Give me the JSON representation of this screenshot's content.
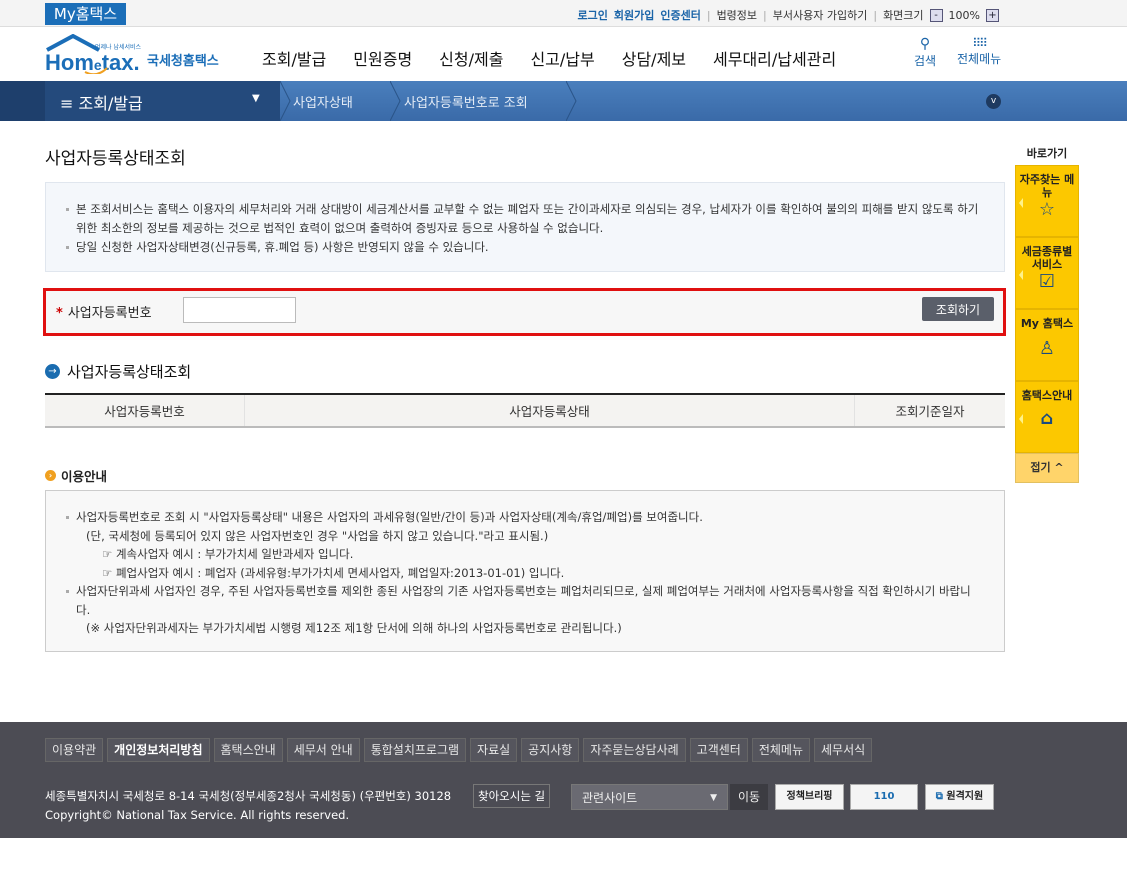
{
  "topbar": {
    "my_hometax": "My홈택스",
    "links": [
      "로그인",
      "회원가입",
      "인증센터",
      "법령정보",
      "부서사용자 가입하기",
      "화면크기"
    ],
    "zoom": "100%",
    "zoom_minus": "-",
    "zoom_plus": "+"
  },
  "header": {
    "logo_text": "Hometax",
    "logo_sub": "국세청홈택스",
    "logo_tag": "언제나 납세서비스",
    "gnb": [
      "조회/발급",
      "민원증명",
      "신청/제출",
      "신고/납부",
      "상담/제보",
      "세무대리/납세관리"
    ],
    "search": "검색",
    "all_menu": "전체메뉴"
  },
  "nav": {
    "current": "조회/발급",
    "crumbs": [
      "사업자상태",
      "사업자등록번호로 조회"
    ]
  },
  "page": {
    "title": "사업자등록상태조회",
    "info": [
      "본 조회서비스는 홈택스 이용자의 세무처리와 거래 상대방이 세금계산서를 교부할 수 없는 폐업자 또는 간이과세자로 의심되는 경우, 납세자가 이를 확인하여 불의의 피해를 받지 않도록 하기 위한 최소한의 정보를 제공하는 것으로 법적인 효력이 없으며 출력하여 증빙자료 등으로 사용하실 수 없습니다.",
      "당일 신청한 사업자상태변경(신규등록, 휴.폐업 등) 사항은 반영되지 않을 수 있습니다."
    ],
    "search": {
      "required": "*",
      "label": "사업자등록번호",
      "value": "",
      "button": "조회하기"
    },
    "result_title": "사업자등록상태조회",
    "columns": [
      "사업자등록번호",
      "사업자등록상태",
      "조회기준일자"
    ],
    "guide_title": "이용안내",
    "guide": [
      "사업자등록번호로 조회 시 \"사업자등록상태\" 내용은 사업자의 과세유형(일반/간이 등)과 사업자상태(계속/휴업/폐업)를 보여줍니다.",
      "(단, 국세청에 등록되어 있지 않은 사업자번호인 경우 \"사업을 하지 않고 있습니다.\"라고 표시됨.)",
      "☞ 계속사업자 예시 : 부가가치세 일반과세자 입니다.",
      "☞ 폐업사업자 예시 : 폐업자 (과세유형:부가가치세 면세사업자, 폐업일자:2013-01-01) 입니다.",
      "사업자단위과세 사업자인 경우, 주된 사업자등록번호를 제외한 종된 사업장의 기존 사업자등록번호는 폐업처리되므로, 실제 폐업여부는 거래처에 사업자등록사항을 직접 확인하시기 바랍니다.",
      "(※ 사업자단위과세자는 부가가치세법 시행령 제12조 제1항 단서에 의해 하나의 사업자등록번호로 관리됩니다.)"
    ]
  },
  "quick": {
    "title": "바로가기",
    "items": [
      {
        "label": "자주찾는 메뉴",
        "icon": "star-icon"
      },
      {
        "label": "세금종류별 서비스",
        "icon": "checkbox-icon"
      },
      {
        "label": "My 홈택스",
        "icon": "person-icon"
      },
      {
        "label": "홈택스안내",
        "icon": "house-hand-icon"
      }
    ],
    "fold": "접기 ^"
  },
  "footer": {
    "links": [
      "이용약관",
      "개인정보처리방침",
      "홈택스안내",
      "세무서 안내",
      "통합설치프로그램",
      "자료실",
      "공지사항",
      "자주묻는상담사례",
      "고객센터",
      "전체메뉴",
      "세무서식"
    ],
    "address": "세종특별자치시 국세청로 8-14 국세청(정부세종2청사 국세청동) (우편번호) 30128",
    "find_way": "찾아오시는 길",
    "related": "관련사이트",
    "go": "이동",
    "copyright": "Copyright© National Tax Service. All rights reserved.",
    "banners": [
      "정책브리핑",
      "110",
      "원격지원"
    ]
  },
  "colors": {
    "brand_blue": "#1b6eb8",
    "nav_dark": "#244a7c",
    "quick_yellow": "#fcc800",
    "highlight_red": "#e01010",
    "footer_bg": "#4c4c54"
  }
}
